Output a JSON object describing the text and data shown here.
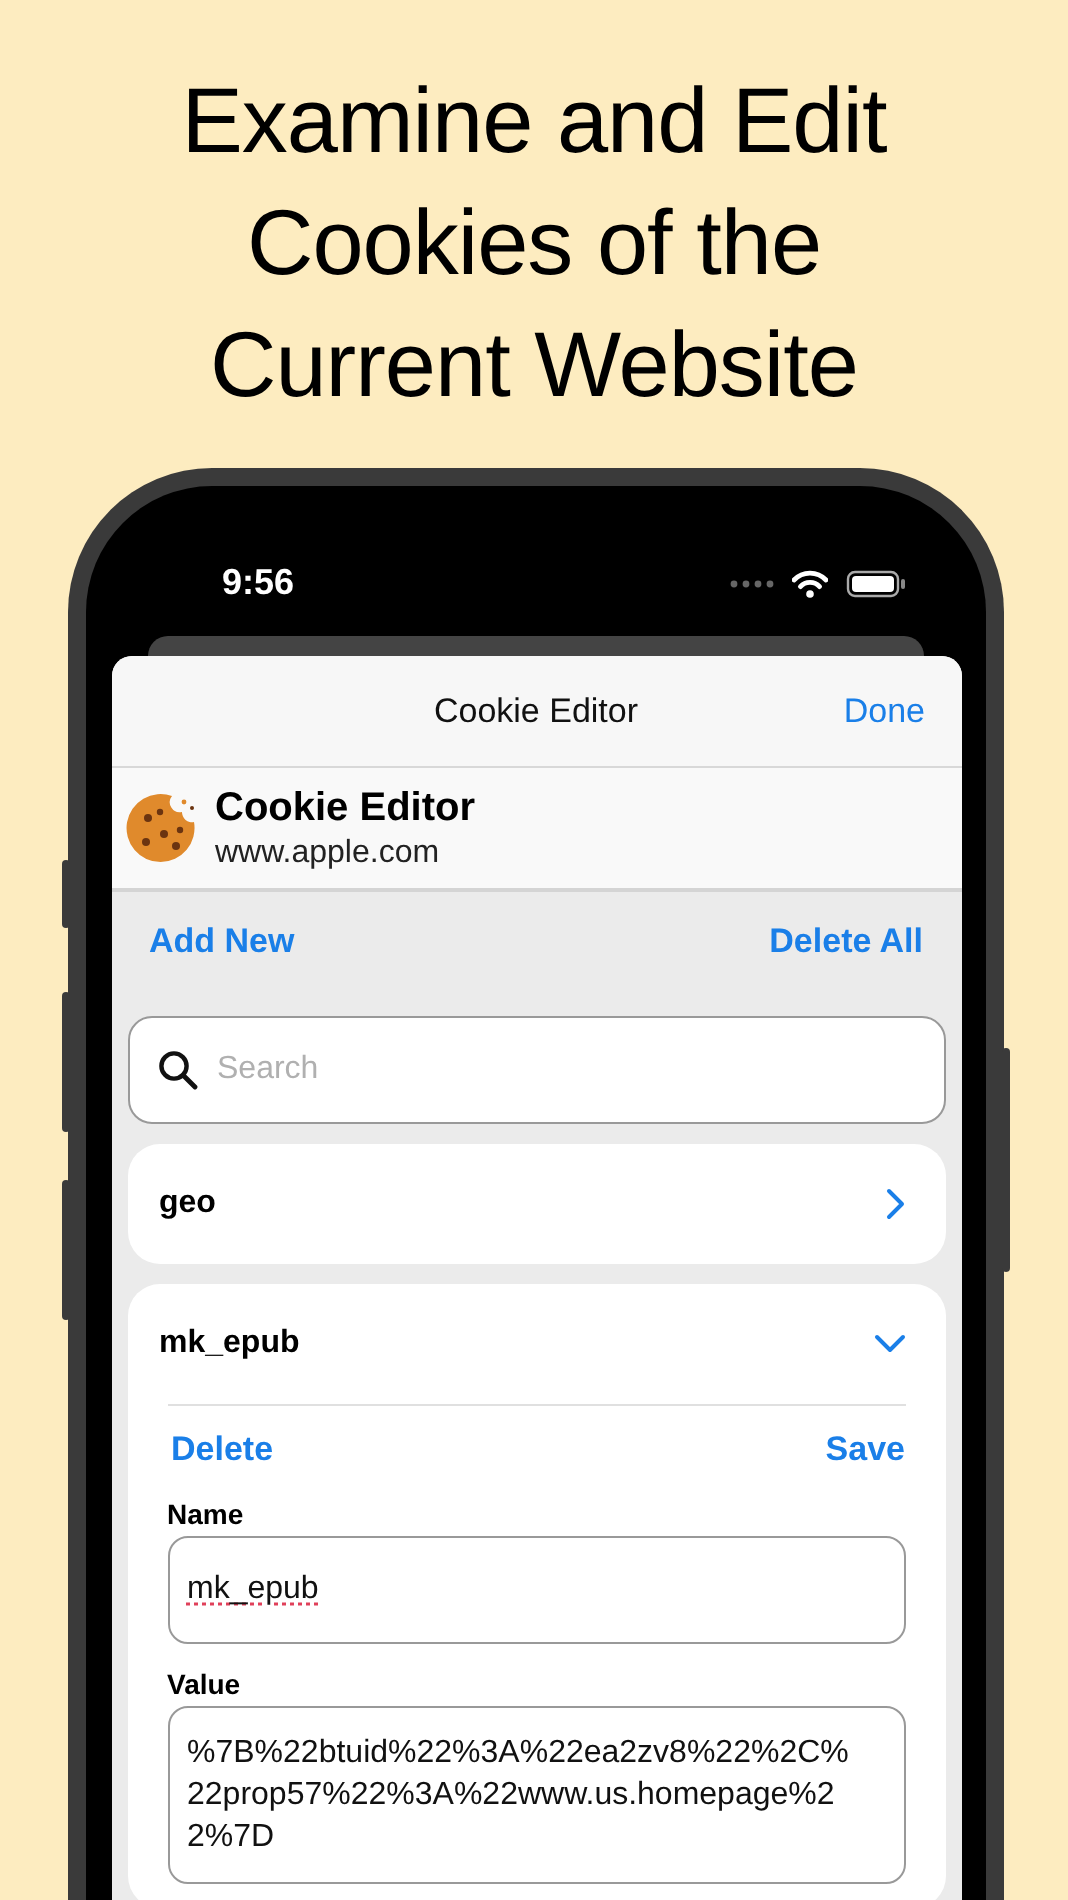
{
  "headline": [
    "Examine and Edit",
    "Cookies of the",
    "Current Website"
  ],
  "status_bar": {
    "time": "9:56"
  },
  "nav": {
    "title": "Cookie Editor",
    "done": "Done"
  },
  "extension": {
    "name": "Cookie Editor",
    "domain": "www.apple.com"
  },
  "toolbar": {
    "add": "Add New",
    "delete_all": "Delete All"
  },
  "search": {
    "placeholder": "Search"
  },
  "cookies": [
    {
      "name": "geo",
      "expanded": false
    },
    {
      "name": "mk_epub",
      "expanded": true,
      "actions": [
        "Delete",
        "Save"
      ],
      "fields": [
        {
          "kind": "line",
          "label": "Name",
          "value": "mk_epub"
        },
        {
          "kind": "area",
          "label": "Value",
          "value": "%7B%22btuid%22%3A%22ea2zv8%22%2C%22prop57%22%3A%22www.us.homepage%22%7D"
        }
      ]
    }
  ]
}
